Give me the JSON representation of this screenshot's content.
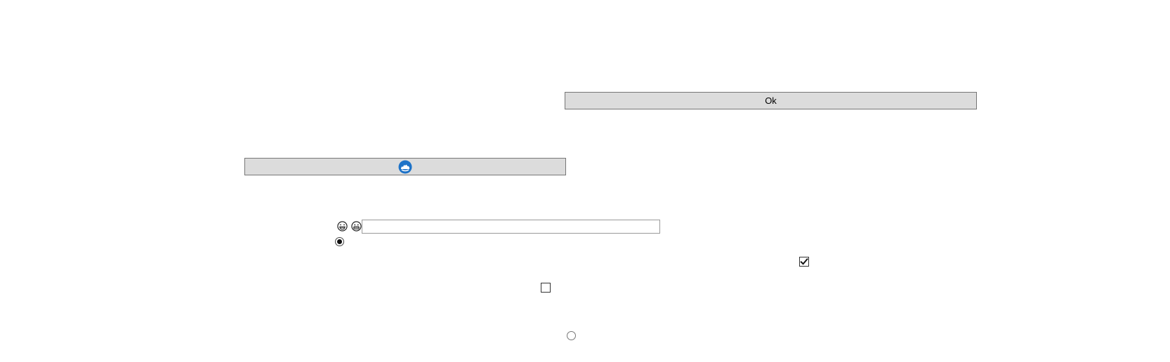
{
  "ok_button": {
    "label": "Ok"
  },
  "icon_button": {
    "icon": "cloud-swirl-icon",
    "icon_color": "#1e73c8"
  },
  "emoji_row": {
    "icons": [
      "laughing-face-icon",
      "grinning-face-icon"
    ],
    "input_value": "",
    "input_placeholder": ""
  },
  "radio_1": {
    "checked": true
  },
  "radio_2": {
    "checked": false
  },
  "checkbox_1": {
    "checked": true
  },
  "checkbox_2": {
    "checked": false
  }
}
